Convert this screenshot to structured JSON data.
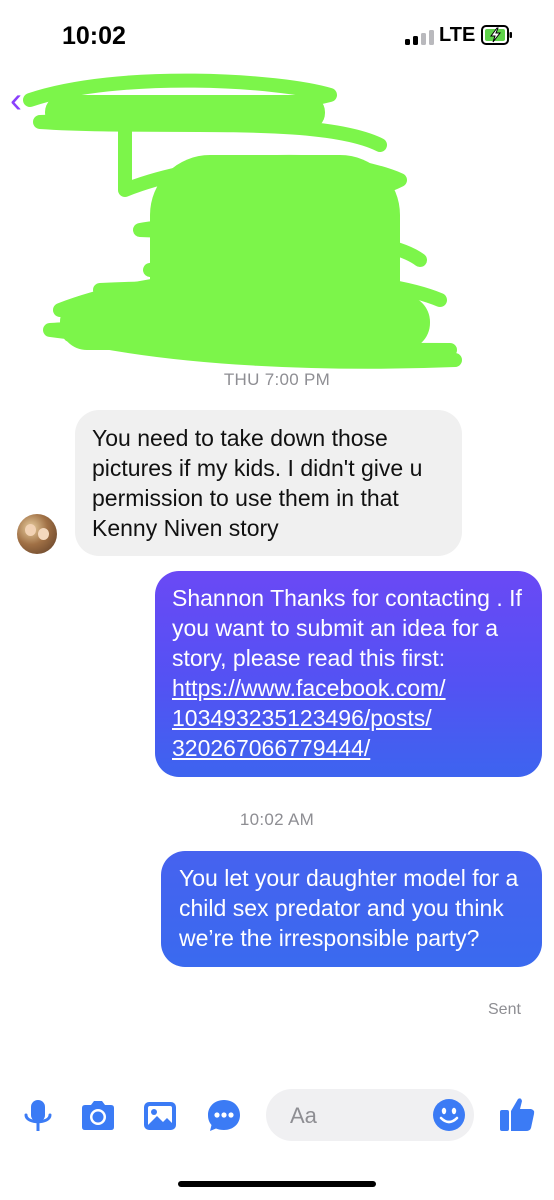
{
  "status_bar": {
    "time": "10:02",
    "network": "LTE",
    "battery_color": "#5fd34a"
  },
  "header": {
    "back_color": "#8a3ffc",
    "scribble_color": "#7cf54a"
  },
  "conversation": {
    "timestamp_1": "THU 7:00 PM",
    "incoming_message": "You need to take down those pictures if my kids. I didn't give u permission to use them in that Kenny Niven story",
    "outgoing_message_1": {
      "text": "Shannon Thanks for contacting . If you want to submit an idea for a story, please read this first:",
      "link_line_1": "https://www.facebook.com/",
      "link_line_2": "103493235123496/posts/",
      "link_line_3": "320267066779444/"
    },
    "timestamp_2": "10:02 AM",
    "outgoing_message_2": "You let your daughter model for a child sex predator and you think we’re the irresponsible party?",
    "delivery_status": "Sent"
  },
  "composer": {
    "placeholder": "Aa",
    "icons": [
      "microphone-icon",
      "camera-icon",
      "gallery-icon",
      "more-icon",
      "emoji-icon",
      "thumbs-up-icon"
    ],
    "accent_color": "#3b7bf5"
  }
}
